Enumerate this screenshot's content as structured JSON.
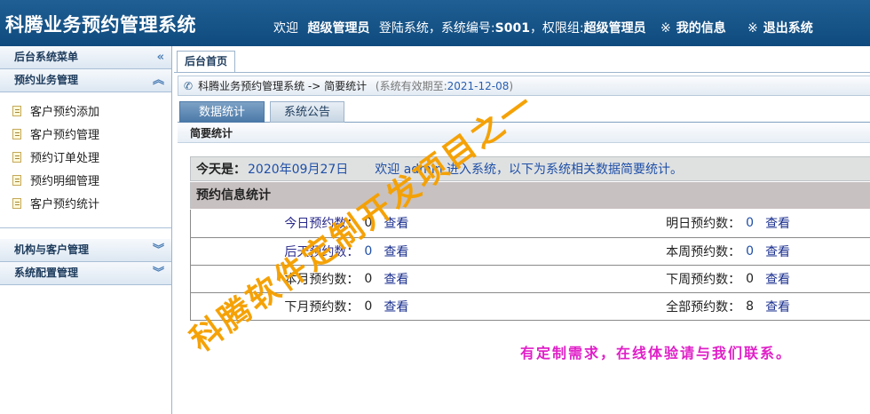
{
  "header": {
    "app_title": "科腾业务预约管理系统",
    "welcome_prefix": "欢迎",
    "username": "超级管理员",
    "login_text": "登陆系统，系统编号:",
    "system_id": "S001",
    "group_text": "，权限组:",
    "group_name": "超级管理员",
    "my_info_mark": "※",
    "my_info_label": "我的信息",
    "logout_mark": "※",
    "logout_label": "退出系统"
  },
  "sidebar": {
    "menu_title": "后台系统菜单",
    "sections": [
      {
        "title": "预约业务管理",
        "expanded": true,
        "items": [
          "客户预约添加",
          "客户预约管理",
          "预约订单处理",
          "预约明细管理",
          "客户预约统计"
        ]
      },
      {
        "title": "机构与客户管理",
        "expanded": false
      },
      {
        "title": "系统配置管理",
        "expanded": false
      }
    ],
    "chevrons": {
      "collapse_double_left": "«",
      "collapse_up": "︽",
      "expand_down": "︾"
    }
  },
  "main": {
    "page_tab": "后台首页",
    "breadcrumb": "科腾业务预约管理系统 -> 简要统计",
    "validity_prefix": "(系统有效期至:",
    "validity_date": "2021-12-08",
    "validity_suffix": ")",
    "tabs": [
      {
        "label": "数据统计",
        "active": true
      },
      {
        "label": "系统公告",
        "active": false
      }
    ],
    "summary_label": "简要统计",
    "today_label": "今天是：",
    "today_date": "2020年09月27日",
    "welcome_text": "欢迎 admin 进入系统，以下为系统相关数据简要统计。",
    "stats_title": "预约信息统计",
    "view_label": "查看",
    "stats": [
      [
        {
          "label": "今日预约数：",
          "value": "0"
        },
        {
          "label": "明日预约数：",
          "value": "0"
        }
      ],
      [
        {
          "label": "后天预约数：",
          "value": "0"
        },
        {
          "label": "本周预约数：",
          "value": "0"
        }
      ],
      [
        {
          "label": "本月预约数：",
          "value": "0"
        },
        {
          "label": "下周预约数：",
          "value": "0"
        }
      ],
      [
        {
          "label": "下月预约数：",
          "value": "0"
        },
        {
          "label": "全部预约数：",
          "value": "8"
        }
      ]
    ],
    "contact_note": "有定制需求，在线体验请与我们联系。"
  },
  "watermark": "科腾软件定制开发项目之一",
  "colors": {
    "header_bg": "#134d82",
    "sidebar_head_text": "#1d3b5c",
    "link_blue": "#1f4fa7",
    "contact_magenta": "#e020c8",
    "watermark_orange": "#f5a000"
  }
}
